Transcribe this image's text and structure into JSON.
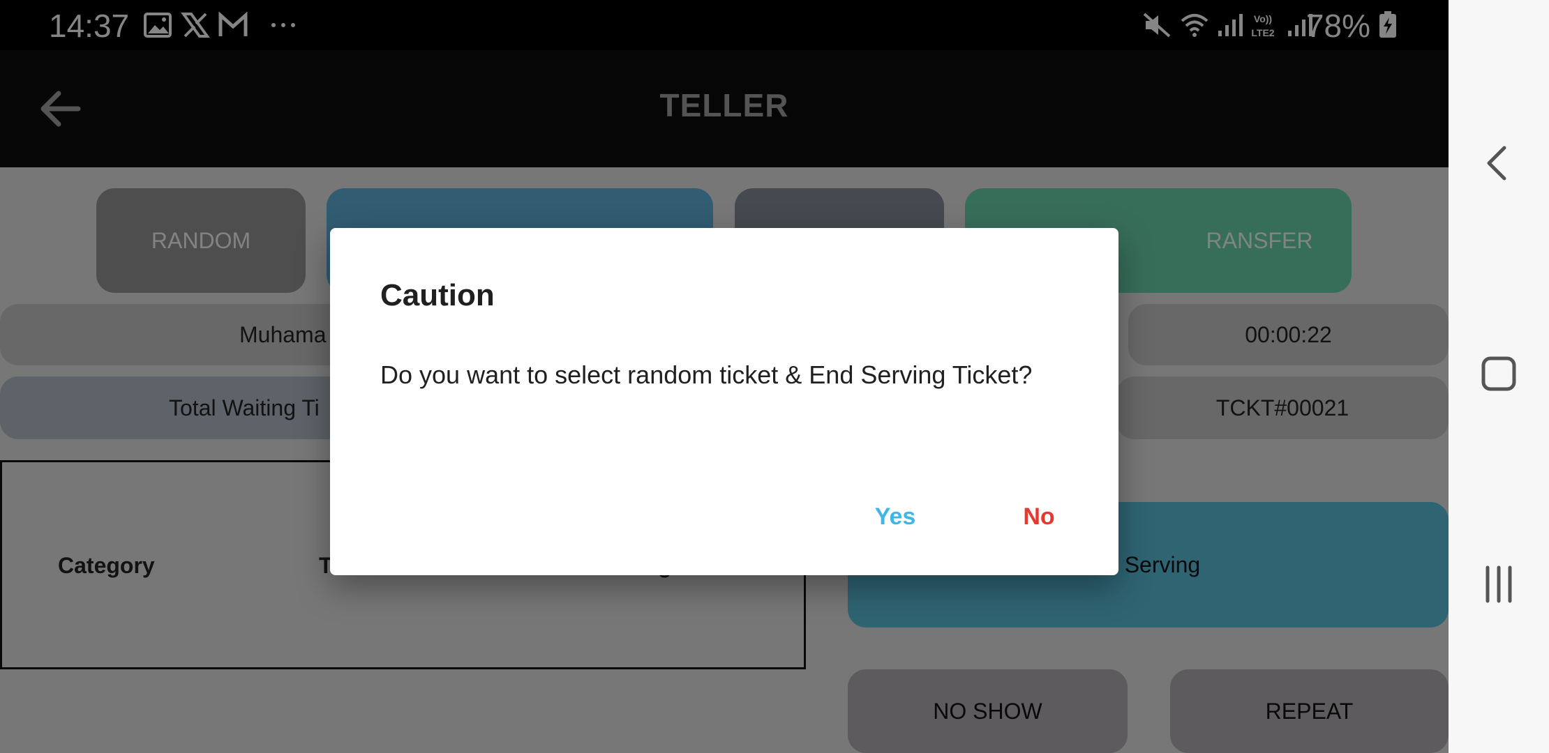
{
  "status_bar": {
    "time": "14:37",
    "notification_icons": [
      "image-icon",
      "x-icon",
      "gmail-icon",
      "more-dots-icon"
    ],
    "right_icons": [
      "mute-icon",
      "wifi-icon",
      "signal-icon",
      "volte-lte2-icon",
      "signal-icon",
      "battery-charging-icon"
    ],
    "battery": "78%"
  },
  "app_bar": {
    "back_icon": "arrow-left-icon",
    "title": "TELLER"
  },
  "actions": {
    "random": "RANDOM",
    "transfer_partial": "RANSFER"
  },
  "info": {
    "user_partial": "Muhama",
    "timer": "00:00:22",
    "waiting_partial": "Total Waiting Ti",
    "ticket": "TCKT#00021"
  },
  "table": {
    "col_category": "Category",
    "col_t_partial": "T",
    "col_g_partial": "g"
  },
  "serving": {
    "end_serving_partial": "d Serving",
    "no_show": "NO SHOW",
    "repeat": "REPEAT"
  },
  "dialog": {
    "title": "Caution",
    "message": "Do you want to select random ticket & End Serving Ticket?",
    "yes": "Yes",
    "no": "No"
  },
  "colors": {
    "yes": "#3fb6e8",
    "no": "#e5382e",
    "primary_blue": "#5aa8d0",
    "transfer_green": "#64c9a4",
    "end_serving": "#57b7d2"
  },
  "nav_bar": {
    "icons": [
      "back-chevron-icon",
      "home-square-icon",
      "recents-icon"
    ]
  }
}
